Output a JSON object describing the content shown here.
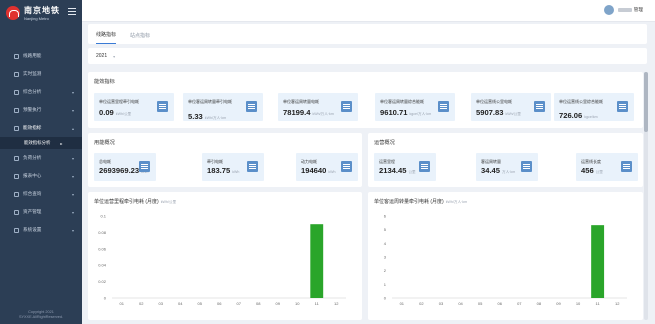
{
  "sidebar": {
    "logo_cn": "南京地铁",
    "logo_en": "Nanjing Metro",
    "items": [
      {
        "label": "线路用能",
        "arrow": ""
      },
      {
        "label": "实时监测",
        "arrow": ""
      },
      {
        "label": "综合分析",
        "arrow": "▾"
      },
      {
        "label": "预警执行",
        "arrow": "▾"
      },
      {
        "label": "能效指标",
        "arrow": "▴"
      },
      {
        "label": "负荷分析",
        "arrow": "▾"
      },
      {
        "label": "报表中心",
        "arrow": "▾"
      },
      {
        "label": "综合查询",
        "arrow": "▾"
      },
      {
        "label": "资产管理",
        "arrow": "▾"
      },
      {
        "label": "系统设置",
        "arrow": "▾"
      }
    ],
    "sub_item": "能效指标分析",
    "sub_arrow": "▸",
    "footer_line1": "Copyright 2021",
    "footer_line2": "SYXXE.AllRightReserved."
  },
  "header": {
    "user_suffix": "管理"
  },
  "tabs": [
    {
      "label": "线路指标"
    },
    {
      "label": "站点指标"
    }
  ],
  "filter": {
    "year": "2021",
    "caret": "▾"
  },
  "efficiency": {
    "title": "能效指标",
    "metrics": [
      {
        "label": "单位运营里程牵引电耗",
        "value": "0.09",
        "unit": "kWh/公里"
      },
      {
        "label": "单位客运周转量牵引电耗",
        "value": "5.33",
        "unit": "kWh/万人·km"
      },
      {
        "label": "单位客运周转量电耗",
        "value": "78199.4",
        "unit": "kWh/万人·km"
      },
      {
        "label": "单位客运周转量综合能耗",
        "value": "9610.71",
        "unit": "kgce/万人·km"
      },
      {
        "label": "单位运营线公里电耗",
        "value": "5907.83",
        "unit": "kWh/公里"
      },
      {
        "label": "单位运营线公里综合能耗",
        "value": "726.06",
        "unit": "kgce/km"
      }
    ]
  },
  "usage": {
    "title": "用能概况",
    "metrics": [
      {
        "label": "总电耗",
        "value": "2693969.23",
        "unit": "kWh"
      },
      {
        "label": "牵引电耗",
        "value": "183.75",
        "unit": "kWh"
      },
      {
        "label": "动力电耗",
        "value": "194640",
        "unit": "kWh"
      }
    ]
  },
  "operation": {
    "title": "运营概况",
    "metrics": [
      {
        "label": "运营里程",
        "value": "2134.45",
        "unit": "公里"
      },
      {
        "label": "客运周转量",
        "value": "34.45",
        "unit": "万人·km"
      },
      {
        "label": "运营线长度",
        "value": "456",
        "unit": "公里"
      }
    ]
  },
  "colors": {
    "bar": "#2aa52a",
    "accent": "#3a7bd5"
  },
  "chart_data": [
    {
      "type": "bar",
      "title": "单位运营里程牵引电耗 (月度)",
      "unit": "kWh/公里",
      "categories": [
        "01",
        "02",
        "03",
        "04",
        "05",
        "06",
        "07",
        "08",
        "09",
        "10",
        "11",
        "12"
      ],
      "values": [
        0,
        0,
        0,
        0,
        0,
        0,
        0,
        0,
        0,
        0,
        0.09,
        0
      ],
      "yticks": [
        "0",
        "0.02",
        "0.04",
        "0.06",
        "0.08",
        "0.1"
      ],
      "ylim": [
        0,
        0.1
      ]
    },
    {
      "type": "bar",
      "title": "单位客运周转量牵引电耗 (月度)",
      "unit": "kWh/万人·km",
      "categories": [
        "01",
        "02",
        "03",
        "04",
        "05",
        "06",
        "07",
        "08",
        "09",
        "10",
        "11",
        "12"
      ],
      "values": [
        0,
        0,
        0,
        0,
        0,
        0,
        0,
        0,
        0,
        0,
        5.33,
        0
      ],
      "yticks": [
        "0",
        "1",
        "2",
        "3",
        "4",
        "5",
        "6"
      ],
      "ylim": [
        0,
        6
      ]
    }
  ]
}
